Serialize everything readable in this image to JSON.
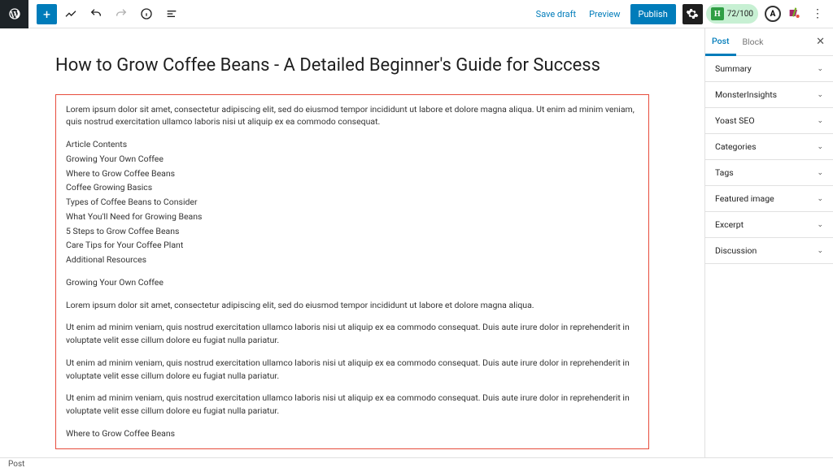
{
  "topbar": {
    "save_draft": "Save draft",
    "preview": "Preview",
    "publish": "Publish",
    "score": "72/100"
  },
  "sidebar": {
    "tabs": {
      "post": "Post",
      "block": "Block"
    },
    "panels": [
      "Summary",
      "MonsterInsights",
      "Yoast SEO",
      "Categories",
      "Tags",
      "Featured image",
      "Excerpt",
      "Discussion"
    ]
  },
  "post": {
    "title": "How to Grow Coffee Beans - A Detailed Beginner's Guide for Success",
    "intro": "Lorem ipsum dolor sit amet, consectetur adipiscing elit, sed do eiusmod tempor incididunt ut labore et dolore magna aliqua. Ut enim ad minim veniam, quis nostrud exercitation ullamco laboris nisi ut aliquip ex ea commodo consequat.",
    "toc_heading": "Article Contents",
    "toc": [
      "Growing Your Own Coffee",
      "Where to Grow Coffee Beans",
      "Coffee Growing Basics",
      "Types of Coffee Beans to Consider",
      "What You'll Need for Growing Beans",
      "5 Steps to Grow Coffee Beans",
      "Care Tips for Your Coffee Plant",
      "Additional Resources"
    ],
    "section1_heading": "Growing Your Own Coffee",
    "para1": "Lorem ipsum dolor sit amet, consectetur adipiscing elit, sed do eiusmod tempor incididunt ut labore et dolore magna aliqua.",
    "para2": "Ut enim ad minim veniam, quis nostrud exercitation ullamco laboris nisi ut aliquip ex ea commodo consequat. Duis aute irure dolor in reprehenderit in voluptate velit esse cillum dolore eu fugiat nulla pariatur.",
    "para3": "Ut enim ad minim veniam, quis nostrud exercitation ullamco laboris nisi ut aliquip ex ea commodo consequat. Duis aute irure dolor in reprehenderit in voluptate velit esse cillum dolore eu fugiat nulla pariatur.",
    "para4": "Ut enim ad minim veniam, quis nostrud exercitation ullamco laboris nisi ut aliquip ex ea commodo consequat. Duis aute irure dolor in reprehenderit in voluptate velit esse cillum dolore eu fugiat nulla pariatur.",
    "section2_heading": "Where to Grow Coffee Beans"
  },
  "footer": {
    "breadcrumb": "Post"
  }
}
